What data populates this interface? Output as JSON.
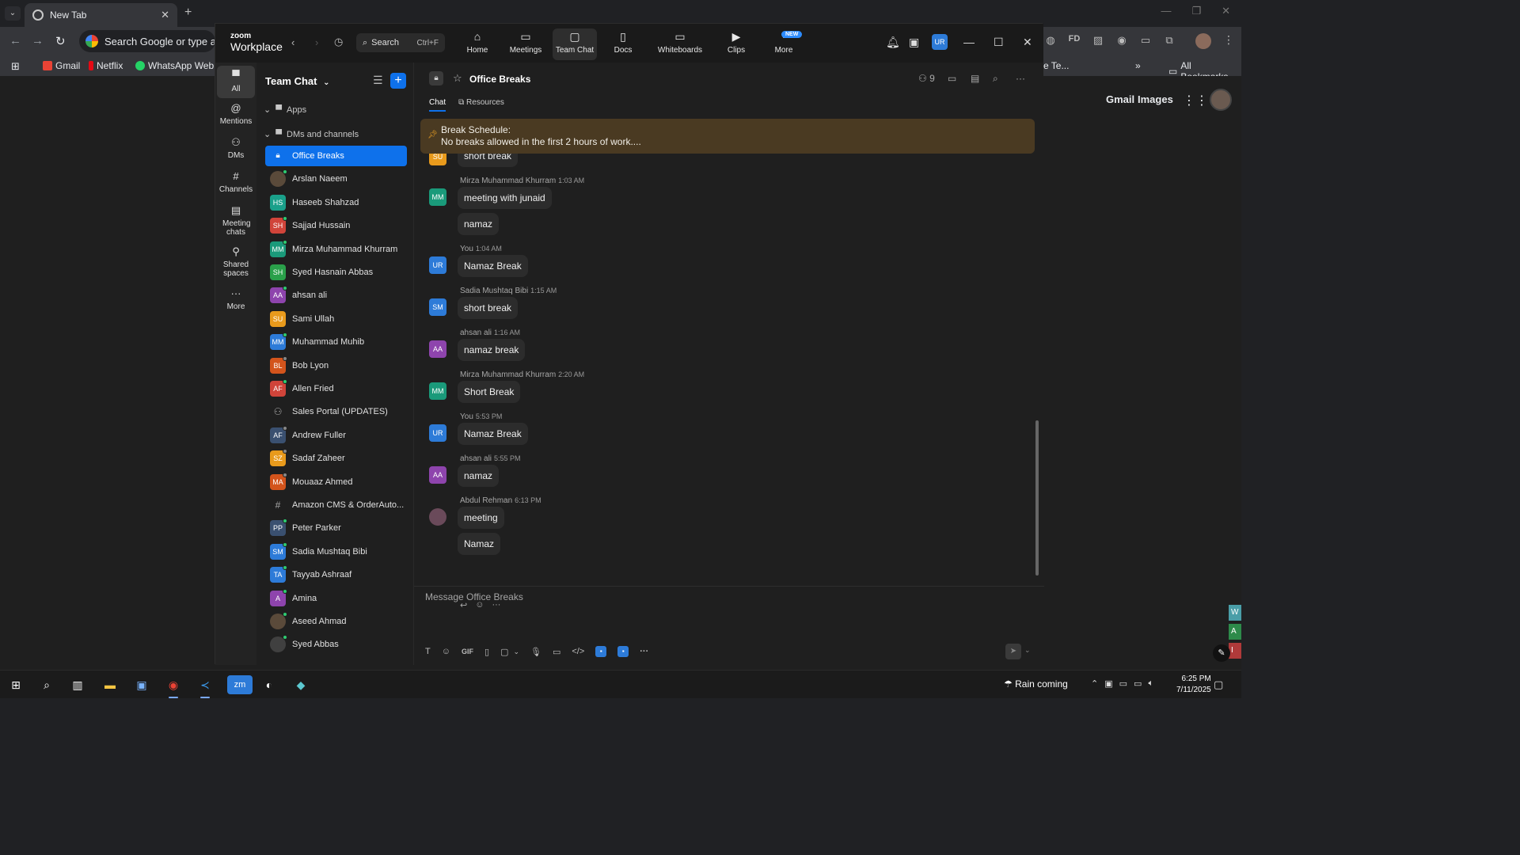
{
  "browser": {
    "tab_title": "New Tab",
    "omnibox_placeholder": "Search Google or type a URL",
    "bookmarks": [
      {
        "label": "Gmail",
        "color": "#ea4335"
      },
      {
        "label": "Netflix",
        "color": "#e50914"
      },
      {
        "label": "WhatsApp Web",
        "color": "#25d366"
      }
    ],
    "bookmarks_partial": "e Te...",
    "all_bookmarks": "All Bookmarks",
    "google_links": [
      "Gmail",
      "Images"
    ]
  },
  "zoom": {
    "logo_top": "zoom",
    "logo_bottom": "Workplace",
    "search_label": "Search",
    "search_shortcut": "Ctrl+F",
    "tabs": [
      {
        "label": "Home",
        "icon": "home-icon"
      },
      {
        "label": "Meetings",
        "icon": "video-icon"
      },
      {
        "label": "Team Chat",
        "icon": "chat-icon"
      },
      {
        "label": "Docs",
        "icon": "doc-icon"
      },
      {
        "label": "Whiteboards",
        "icon": "whiteboard-icon"
      },
      {
        "label": "Clips",
        "icon": "clips-icon"
      },
      {
        "label": "More",
        "icon": "more-icon"
      }
    ],
    "new_badge": "NEW",
    "user_initials": "UR",
    "rail": [
      {
        "label": "All",
        "icon": "chat-bubble-icon"
      },
      {
        "label": "Mentions",
        "icon": "at-icon"
      },
      {
        "label": "DMs",
        "icon": "people-icon"
      },
      {
        "label": "Channels",
        "icon": "hash-icon"
      },
      {
        "label": "Meeting chats",
        "icon": "calendar-icon"
      },
      {
        "label": "Shared spaces",
        "icon": "share-icon"
      },
      {
        "label": "More",
        "icon": "ellipsis-icon"
      }
    ],
    "list": {
      "title": "Team Chat",
      "section_apps": "Apps",
      "section_dms": "DMs and channels",
      "items": [
        {
          "name": "Office Breaks",
          "initials": "",
          "color": "#0e71eb",
          "kind": "lock",
          "active": true
        },
        {
          "name": "Arslan Naeem",
          "initials": "",
          "color": "#5a4a3a",
          "status": "#2ecc71",
          "kind": "photo"
        },
        {
          "name": "Haseeb Shahzad",
          "initials": "HS",
          "color": "#1aa08a",
          "status": ""
        },
        {
          "name": "Sajjad Hussain",
          "initials": "SH",
          "color": "#d0443a",
          "status": "#2ecc71"
        },
        {
          "name": "Mirza Muhammad Khurram",
          "initials": "MM",
          "color": "#1a9a7a",
          "status": "#2ecc71"
        },
        {
          "name": "Syed Hasnain Abbas",
          "initials": "SH",
          "color": "#2aa04a",
          "status": ""
        },
        {
          "name": "ahsan ali",
          "initials": "AA",
          "color": "#8e44ad",
          "status": "#2ecc71"
        },
        {
          "name": "Sami Ullah",
          "initials": "SU",
          "color": "#e89a1c",
          "status": ""
        },
        {
          "name": "Muhammad Muhib",
          "initials": "MM",
          "color": "#2d7bd8",
          "status": "#2ecc71"
        },
        {
          "name": "Bob Lyon",
          "initials": "BL",
          "color": "#d3541c",
          "status": "#888"
        },
        {
          "name": "Allen Fried",
          "initials": "AF",
          "color": "#d0443a",
          "status": "#2ecc71"
        },
        {
          "name": "Sales Portal (UPDATES)",
          "initials": "",
          "color": "#3a3a3a",
          "kind": "group"
        },
        {
          "name": "Andrew Fuller",
          "initials": "AF",
          "color": "#3a5070",
          "status": "#888"
        },
        {
          "name": "Sadaf Zaheer",
          "initials": "SZ",
          "color": "#e89a1c",
          "status": "#888"
        },
        {
          "name": "Mouaaz Ahmed",
          "initials": "MA",
          "color": "#d3541c",
          "status": "#888"
        },
        {
          "name": "Amazon CMS & OrderAuto...",
          "initials": "#",
          "color": "#2b2b2b",
          "kind": "channel"
        },
        {
          "name": "Peter Parker",
          "initials": "PP",
          "color": "#3a5070",
          "status": "#2ecc71"
        },
        {
          "name": "Sadia Mushtaq Bibi",
          "initials": "SM",
          "color": "#2d7bd8",
          "status": "#2ecc71"
        },
        {
          "name": "Tayyab Ashraaf",
          "initials": "TA",
          "color": "#2d7bd8",
          "status": "#2ecc71"
        },
        {
          "name": "Amina",
          "initials": "A",
          "color": "#8e44ad",
          "status": "#2ecc71"
        },
        {
          "name": "Aseed Ahmad",
          "initials": "",
          "color": "#5a4a3a",
          "status": "#2ecc71",
          "kind": "photo"
        },
        {
          "name": "Syed Abbas",
          "initials": "",
          "color": "#404040",
          "status": "#2ecc71",
          "kind": "photo"
        }
      ]
    },
    "channel": {
      "title": "Office Breaks",
      "member_count": "9",
      "tab_chat": "Chat",
      "tab_resources": "Resources",
      "pinned_title": "Break Schedule:",
      "pinned_text": "No breaks allowed in the first 2 hours of work...."
    },
    "messages": [
      {
        "kind": "partial",
        "avatar": "SU",
        "color": "#e89a1c",
        "text": "short break"
      },
      {
        "kind": "group",
        "avatar": "MM",
        "color": "#1a9a7a",
        "sender": "Mirza Muhammad Khurram",
        "time": "1:03 AM",
        "texts": [
          "meeting with junaid",
          "namaz"
        ]
      },
      {
        "kind": "group",
        "avatar": "UR",
        "color": "#2d7bd8",
        "sender": "You",
        "time": "1:04 AM",
        "texts": [
          "Namaz Break"
        ]
      },
      {
        "kind": "group",
        "avatar": "SM",
        "color": "#2d7bd8",
        "sender": "Sadia Mushtaq Bibi",
        "time": "1:15 AM",
        "texts": [
          "short break"
        ]
      },
      {
        "kind": "group",
        "avatar": "AA",
        "color": "#8e44ad",
        "sender": "ahsan ali",
        "time": "1:16 AM",
        "texts": [
          "namaz break"
        ]
      },
      {
        "kind": "group",
        "avatar": "MM",
        "color": "#1a9a7a",
        "sender": "Mirza Muhammad Khurram",
        "time": "2:20 AM",
        "texts": [
          "Short Break"
        ]
      },
      {
        "kind": "group",
        "avatar": "UR",
        "color": "#2d7bd8",
        "sender": "You",
        "time": "5:53 PM",
        "texts": [
          "Namaz Break"
        ]
      },
      {
        "kind": "group",
        "avatar": "AA",
        "color": "#8e44ad",
        "sender": "ahsan ali",
        "time": "5:55 PM",
        "texts": [
          "namaz"
        ]
      },
      {
        "kind": "group",
        "avatar": "",
        "color": "#6a4a5a",
        "sender": "Abdul Rehman",
        "time": "6:13 PM",
        "texts": [
          "meeting",
          "Namaz"
        ]
      }
    ],
    "composer_placeholder": "Message Office Breaks",
    "composer_gif": "GIF"
  },
  "taskbar": {
    "weather": "Rain coming",
    "time": "6:25 PM",
    "date": "7/11/2025",
    "zoom_label": "zm"
  }
}
